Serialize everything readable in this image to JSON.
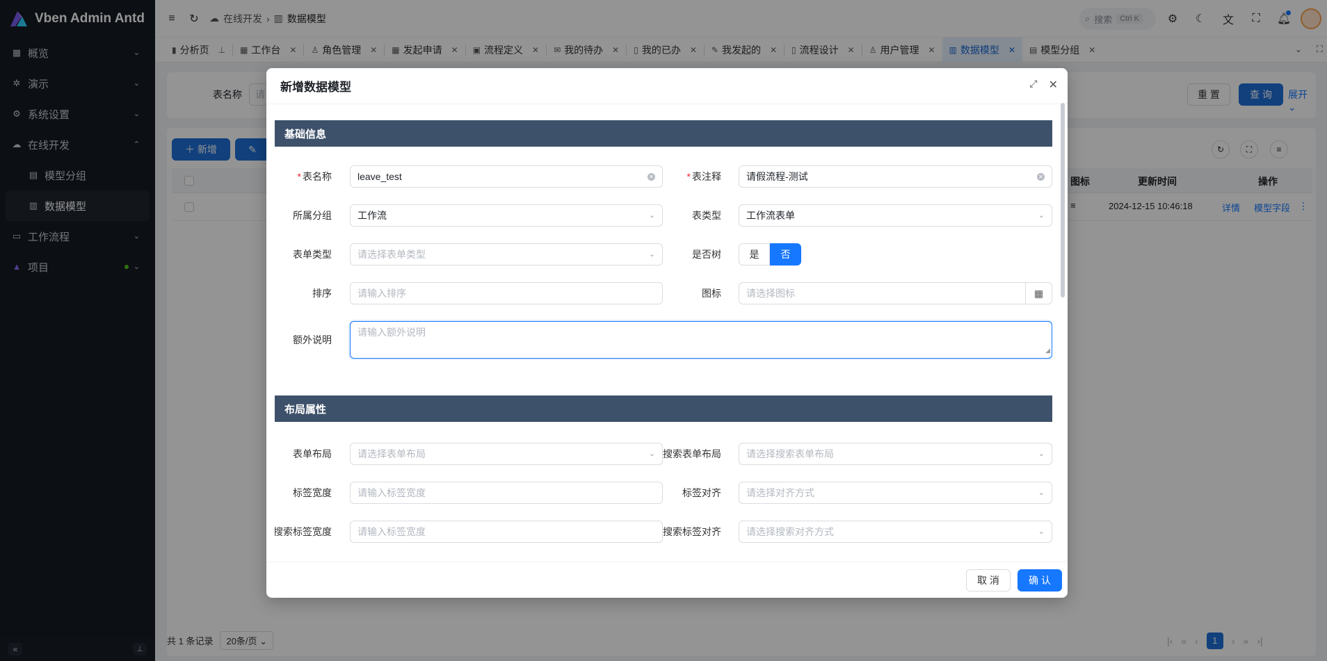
{
  "app": {
    "name": "Vben Admin Antd"
  },
  "sidebar": {
    "items": [
      {
        "label": "概览",
        "icon": "grid-icon"
      },
      {
        "label": "演示",
        "icon": "demo-icon"
      },
      {
        "label": "系统设置",
        "icon": "gear-icon"
      },
      {
        "label": "在线开发",
        "icon": "cloud-icon",
        "expanded": true
      },
      {
        "label": "模型分组",
        "icon": "table-icon",
        "sub": true
      },
      {
        "label": "数据模型",
        "icon": "doc-icon",
        "sub": true,
        "active": true
      },
      {
        "label": "工作流程",
        "icon": "monitor-icon"
      },
      {
        "label": "项目",
        "icon": "logo-icon"
      }
    ]
  },
  "header": {
    "breadcrumb": [
      "在线开发",
      "数据模型"
    ],
    "search_placeholder": "搜索",
    "search_shortcut": "Ctrl K"
  },
  "tabs": [
    {
      "label": "分析页",
      "icon": "chart-icon",
      "pinned": true
    },
    {
      "label": "工作台",
      "icon": "grid-icon"
    },
    {
      "label": "角色管理",
      "icon": "user-role-icon"
    },
    {
      "label": "发起申请",
      "icon": "apps-icon"
    },
    {
      "label": "流程定义",
      "icon": "image-icon"
    },
    {
      "label": "我的待办",
      "icon": "mail-icon"
    },
    {
      "label": "我的已办",
      "icon": "book-icon"
    },
    {
      "label": "我发起的",
      "icon": "edit-icon"
    },
    {
      "label": "流程设计",
      "icon": "file-icon"
    },
    {
      "label": "用户管理",
      "icon": "user-icon"
    },
    {
      "label": "数据模型",
      "icon": "doc-icon",
      "active": true
    },
    {
      "label": "模型分组",
      "icon": "table-icon"
    }
  ],
  "background": {
    "search_label": "表名称",
    "search_placeholder": "请",
    "reset_label": "重 置",
    "query_label": "查 询",
    "expand_label": "展开",
    "add_label": "新增",
    "col_icon": "图标",
    "col_updated": "更新时间",
    "col_action": "操作",
    "row_updated": "2024-12-15 10:46:18",
    "row_detail": "详情",
    "row_fields": "模型字段",
    "total_text": "共 1 条记录",
    "page_size": "20条/页",
    "current_page": "1"
  },
  "modal": {
    "title": "新增数据模型",
    "sections": {
      "basic": "基础信息",
      "layout": "布局属性"
    },
    "fields": {
      "table_name": {
        "label": "表名称",
        "value": "leave_test",
        "required": true
      },
      "table_comment": {
        "label": "表注释",
        "value": "请假流程-测试",
        "required": true
      },
      "group": {
        "label": "所属分组",
        "value": "工作流"
      },
      "table_type": {
        "label": "表类型",
        "value": "工作流表单"
      },
      "form_type": {
        "label": "表单类型",
        "placeholder": "请选择表单类型"
      },
      "is_tree": {
        "label": "是否树",
        "options": [
          "是",
          "否"
        ],
        "selected": "否"
      },
      "sort": {
        "label": "排序",
        "placeholder": "请输入排序"
      },
      "icon": {
        "label": "图标",
        "placeholder": "请选择图标"
      },
      "remark": {
        "label": "额外说明",
        "placeholder": "请输入额外说明"
      },
      "form_layout": {
        "label": "表单布局",
        "placeholder": "请选择表单布局"
      },
      "search_form_layout": {
        "label": "搜索表单布局",
        "placeholder": "请选择搜索表单布局"
      },
      "label_width": {
        "label": "标签宽度",
        "placeholder": "请输入标签宽度"
      },
      "label_align": {
        "label": "标签对齐",
        "placeholder": "请选择对齐方式"
      },
      "search_label_width": {
        "label": "搜索标签宽度",
        "placeholder": "请输入标签宽度"
      },
      "search_label_align": {
        "label": "搜索标签对齐",
        "placeholder": "请选择搜索对齐方式"
      }
    },
    "cancel_label": "取 消",
    "confirm_label": "确 认"
  },
  "colors": {
    "primary": "#1677ff",
    "sidebar_bg": "#151a22",
    "section_bar": "#3e516a",
    "required": "#f5222d"
  }
}
